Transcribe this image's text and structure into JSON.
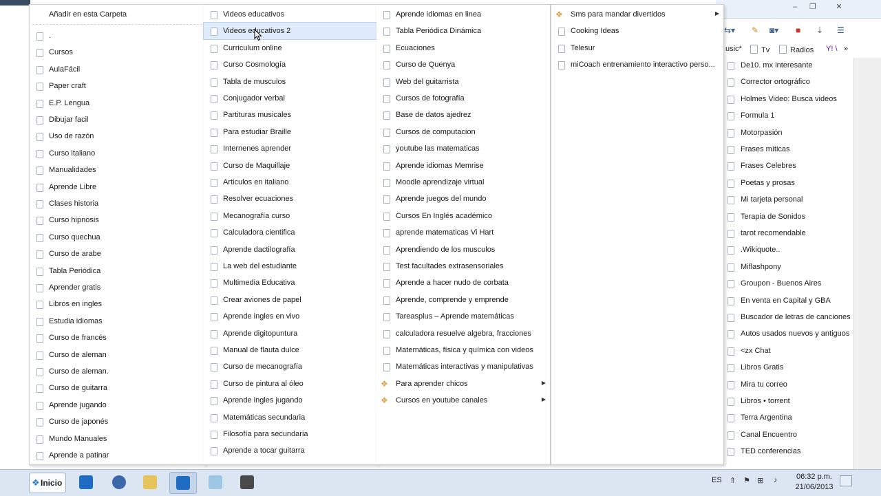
{
  "background_window": {
    "controls": [
      "–",
      "❐",
      "✕"
    ],
    "bookmarks_bar": [
      {
        "label": "usic*"
      },
      {
        "label": "Tv"
      },
      {
        "label": "Radios"
      },
      {
        "label": "Y! \\"
      },
      {
        "label": "»"
      }
    ],
    "list": [
      "De10. mx interesante",
      "Corrector ortográfico",
      "Holmes Video: Busca videos",
      "Formula 1",
      "Motorpasión",
      "Frases míticas",
      "Frases Celebres",
      "Poetas y prosas",
      "Mi tarjeta personal",
      "Terapia de Sonidos",
      "tarot recomendable",
      ".Wikiquote..",
      "Miflashpony",
      "Groupon - Buenos Aires",
      "En venta en Capital y GBA",
      "Buscador de letras de canciones",
      "Autos usados nuevos y antiguos",
      "<zx Chat",
      "Libros Gratis",
      "Mira tu correo",
      "Libros • torrent",
      "Terra Argentina",
      "Canal Encuentro",
      "TED conferencias"
    ]
  },
  "menu1": {
    "add_here": "Añadir en esta Carpeta",
    "items": [
      ".",
      "Cursos",
      "AulaFácil",
      "Paper craft",
      "E.P. Lengua",
      "Dibujar facil",
      "Uso de razón",
      "Curso italiano",
      "Manualidades",
      "Aprende Libre",
      "Clases historia",
      "Curso hipnosis",
      "Curso quechua",
      "Curso de arabe",
      "Tabla Periódica",
      "Aprender gratis",
      "Libros en ingles",
      "Estudia idiomas",
      "Curso de francés",
      "Curso de aleman",
      "Curso de aleman.",
      "Curso de guitarra",
      "Aprende jugando",
      "Curso de japonés",
      "Mundo Manuales",
      "Aprende a patinar"
    ]
  },
  "menu2": {
    "highlighted_index": 1,
    "items": [
      "Videos educativos",
      "Videos educativos 2",
      "Curriculum online",
      "Curso Cosmología",
      "Tabla de musculos",
      "Conjugador verbal",
      "Partituras musicales",
      "Para estudiar Braille",
      "Internenes aprender",
      "Curso de Maquillaje",
      "Articulos en italiano",
      "Resolver ecuaciones",
      "Mecanografía curso",
      "Calculadora cientifica",
      "Aprende dactilografía",
      "La web del estudiante",
      "Multimedia Educativa",
      "Crear aviones de papel",
      "Aprende ingles en vivo",
      "Aprende digitopuntura",
      "Manual de flauta dulce",
      "Curso de mecanografía",
      "Curso de pintura al óleo",
      "Aprende ingles jugando",
      "Matemáticas secundaria",
      "Filosofía para secundaria",
      "Aprende a tocar guitarra"
    ]
  },
  "menu3": {
    "items": [
      {
        "label": "Aprende idiomas en linea",
        "folder": false
      },
      {
        "label": "Tabla Periódica Dinámica",
        "folder": false
      },
      {
        "label": "Ecuaciones",
        "folder": false
      },
      {
        "label": "Curso de Quenya",
        "folder": false
      },
      {
        "label": "Web del guitarrista",
        "folder": false
      },
      {
        "label": "Cursos de fotografía",
        "folder": false
      },
      {
        "label": "Base de datos ajedrez",
        "folder": false
      },
      {
        "label": "Cursos de computacion",
        "folder": false
      },
      {
        "label": "youtube las matematicas",
        "folder": false
      },
      {
        "label": "Aprende idiomas Memrise",
        "folder": false
      },
      {
        "label": "Moodle aprendizaje virtual",
        "folder": false
      },
      {
        "label": "Aprende juegos del mundo",
        "folder": false
      },
      {
        "label": "Cursos En Inglés académico",
        "folder": false
      },
      {
        "label": "aprende matematicas Vi Hart",
        "folder": false
      },
      {
        "label": "Aprendiendo de los musculos",
        "folder": false
      },
      {
        "label": "Test facultades extrasensoriales",
        "folder": false
      },
      {
        "label": "Aprende a hacer nudo de corbata",
        "folder": false
      },
      {
        "label": "Aprende, comprende y emprende",
        "folder": false
      },
      {
        "label": "Tareasplus – Aprende matemáticas",
        "folder": false
      },
      {
        "label": "calculadora resuelve algebra, fracciones",
        "folder": false
      },
      {
        "label": "Matemáticas, física y química con videos",
        "folder": false
      },
      {
        "label": "Matemáticas interactivas y manipulativas",
        "folder": false
      },
      {
        "label": "Para aprender chicos",
        "folder": true
      },
      {
        "label": "Cursos en youtube canales",
        "folder": true
      }
    ]
  },
  "menu4": {
    "items": [
      {
        "label": "Sms para mandar divertidos",
        "folder": true
      },
      {
        "label": "Cooking Ideas",
        "folder": false
      },
      {
        "label": "Telesur",
        "folder": false
      },
      {
        "label": "miCoach entrenamiento interactivo perso...",
        "folder": false
      }
    ]
  },
  "taskbar": {
    "start_label": "Inicio",
    "lang": "ES",
    "time": "06:32 p.m.",
    "date": "21/06/2013"
  }
}
